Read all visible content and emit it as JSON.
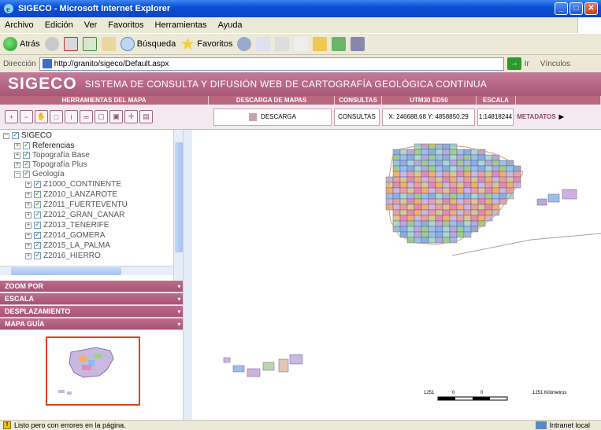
{
  "window": {
    "title": "SIGECO - Microsoft Internet Explorer",
    "min": "_",
    "max": "□",
    "close": "✕"
  },
  "menu": [
    "Archivo",
    "Edición",
    "Ver",
    "Favoritos",
    "Herramientas",
    "Ayuda"
  ],
  "toolbar": {
    "back": "Atrás",
    "search": "Búsqueda",
    "favorites": "Favoritos"
  },
  "address": {
    "label": "Dirección",
    "url": "http://granito/sigeco/Default.aspx",
    "go": "Ir",
    "links": "Vínculos"
  },
  "banner": {
    "logo": "SIGECO",
    "subtitle": "SISTEMA DE CONSULTA Y DIFUSIÓN WEB DE CARTOGRAFÍA GEOLÓGICA CONTINUA"
  },
  "sections": {
    "tools": "HERRAMIENTAS DEL MAPA",
    "download": "DESCARGA DE MAPAS",
    "queries": "CONSULTAS",
    "utm": "UTM30 ED50",
    "scale": "ESCALA"
  },
  "toolrow": {
    "download_btn": "DESCARGA",
    "queries_btn": "CONSULTAS",
    "coords": "X: 246688.68 Y: 4858850.29",
    "scale_value": "1:14818244",
    "metadata": "METADATOS"
  },
  "tree": {
    "root": "SIGECO",
    "items": [
      "Referencias",
      "Topografía Base",
      "Topografía Plus",
      "Geología",
      "Z1000_CONTINENTE",
      "Z2010_LANZAROTE",
      "Z2011_FUERTEVENTU",
      "Z2012_GRAN_CANAR",
      "Z2013_TENERIFE",
      "Z2014_GOMERA",
      "Z2015_LA_PALMA",
      "Z2016_HIERRO"
    ]
  },
  "panels": {
    "zoom": "ZOOM POR",
    "scale": "ESCALA",
    "pan": "DESPLAZAMIENTO",
    "guide": "MAPA GUÍA",
    "arrows": "▾ »"
  },
  "scalebar": {
    "left": "1251",
    "mid1": "0",
    "mid2": "0",
    "right": "1251 Kilómetros"
  },
  "status": {
    "message": "Listo pero con errores en la página.",
    "zone": "Intranet local"
  },
  "colors": {
    "banner": "#b0607f",
    "accent": "#a85275"
  }
}
